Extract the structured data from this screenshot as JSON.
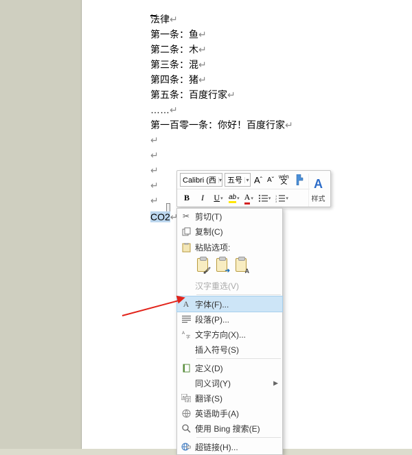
{
  "document": {
    "lines": [
      "法律",
      "第一条：鱼",
      "第二条：木",
      "第三条：混",
      "第四条：猪",
      "第五条：百度行家",
      "……",
      "第一百零一条：你好！百度行家"
    ],
    "co2": "CO2"
  },
  "mini_toolbar": {
    "font_name": "Calibri (西",
    "font_size": "五号",
    "grow": "A",
    "shrink": "A",
    "pinyin": "wén",
    "pinyin2": "文",
    "bold": "B",
    "italic": "I",
    "underline": "U",
    "highlight": "ab",
    "font_color": "A",
    "styles_label": "样式"
  },
  "context_menu": {
    "cut": "剪切(T)",
    "copy": "复制(C)",
    "paste_options": "粘贴选项:",
    "reconvert": "汉字重选(V)",
    "font": "字体(F)...",
    "paragraph": "段落(P)...",
    "text_direction": "文字方向(X)...",
    "insert_symbol": "插入符号(S)",
    "define": "定义(D)",
    "synonyms": "同义词(Y)",
    "translate": "翻译(S)",
    "english_assistant": "英语助手(A)",
    "bing_search": "使用 Bing 搜索(E)",
    "hyperlink": "超链接(H)..."
  }
}
